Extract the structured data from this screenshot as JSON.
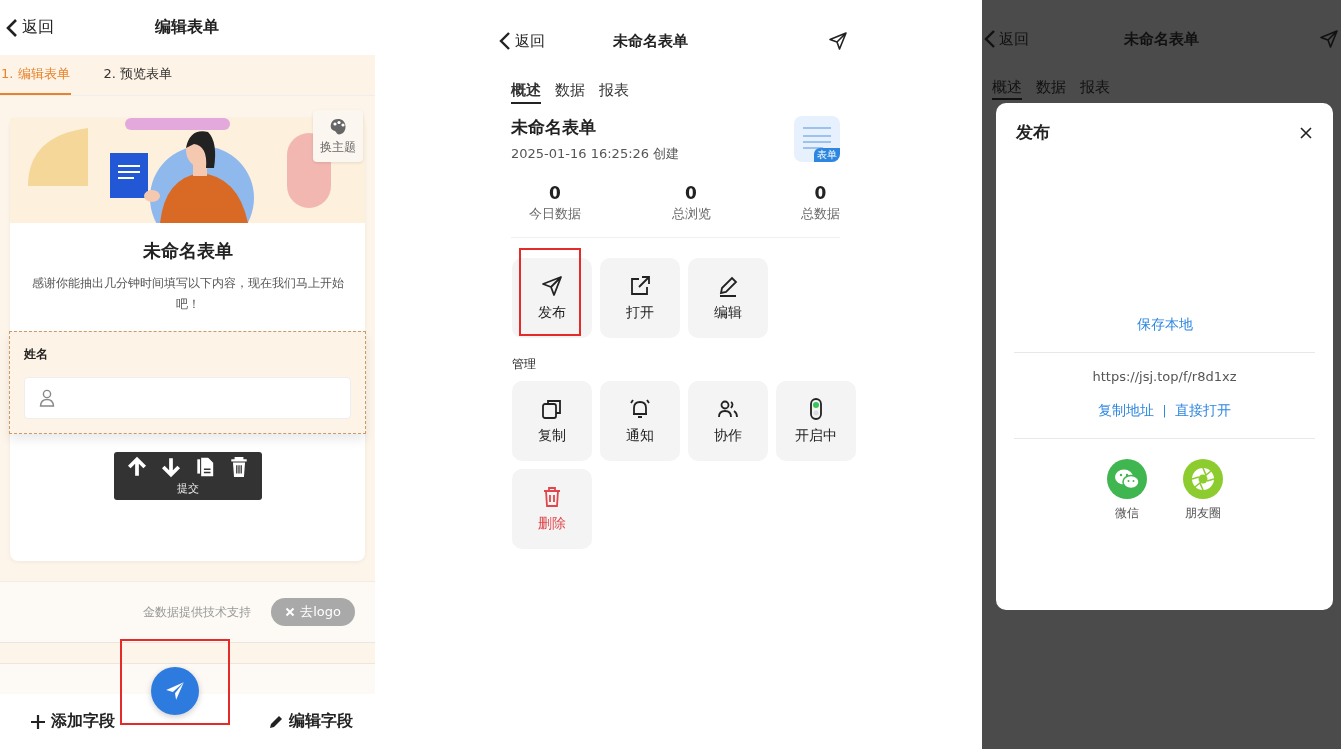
{
  "editor": {
    "nav": {
      "back": "返回",
      "title": "编辑表单"
    },
    "tabs": [
      {
        "label": "1. 编辑表单",
        "selected": true
      },
      {
        "label": "2. 预览表单",
        "selected": false
      }
    ],
    "theme_button": "换主题",
    "form_title": "未命名表单",
    "form_description": "感谢你能抽出几分钟时间填写以下内容，现在我们马上开始吧！",
    "field": {
      "label": "姓名"
    },
    "toolbar_label": "提交",
    "footer": {
      "credit": "金数据提供技术支持",
      "remove_logo": "去logo"
    },
    "publish_fab": {
      "highlighted": true
    },
    "bottom_bar": {
      "add": "添加字段",
      "edit": "编辑字段"
    }
  },
  "detail": {
    "nav": {
      "back": "返回",
      "title": "未命名表单"
    },
    "tabs": [
      {
        "label": "概述",
        "selected": true
      },
      {
        "label": "数据",
        "selected": false
      },
      {
        "label": "报表",
        "selected": false
      }
    ],
    "form": {
      "title": "未命名表单",
      "created": "2025-01-16 16:25:26 创建",
      "badge": "表单"
    },
    "stats": [
      {
        "value": "0",
        "label": "今日数据"
      },
      {
        "value": "0",
        "label": "总浏览"
      },
      {
        "value": "0",
        "label": "总数据"
      }
    ],
    "actions": [
      {
        "label": "发布",
        "kind": "send",
        "highlighted": true
      },
      {
        "label": "打开",
        "kind": "open",
        "highlighted": false
      },
      {
        "label": "编辑",
        "kind": "edit",
        "highlighted": false
      }
    ],
    "manage_heading": "管理",
    "manage": [
      {
        "label": "复制",
        "kind": "copy"
      },
      {
        "label": "通知",
        "kind": "bell"
      },
      {
        "label": "协作",
        "kind": "users"
      },
      {
        "label": "开启中",
        "kind": "toggle",
        "on": true
      },
      {
        "label": "删除",
        "kind": "delete"
      }
    ]
  },
  "publish": {
    "nav": {
      "back": "返回",
      "title": "未命名表单"
    },
    "tabs": [
      {
        "label": "概述",
        "selected": true
      },
      {
        "label": "数据",
        "selected": false
      },
      {
        "label": "报表",
        "selected": false
      }
    ],
    "dialog": {
      "title": "发布",
      "save": "保存本地",
      "url": "https://jsj.top/f/r8d1xz",
      "copy": "复制地址",
      "separator": "|",
      "open": "直接打开",
      "share": [
        {
          "label": "微信",
          "kind": "wechat"
        },
        {
          "label": "朋友圈",
          "kind": "moments"
        }
      ]
    }
  }
}
